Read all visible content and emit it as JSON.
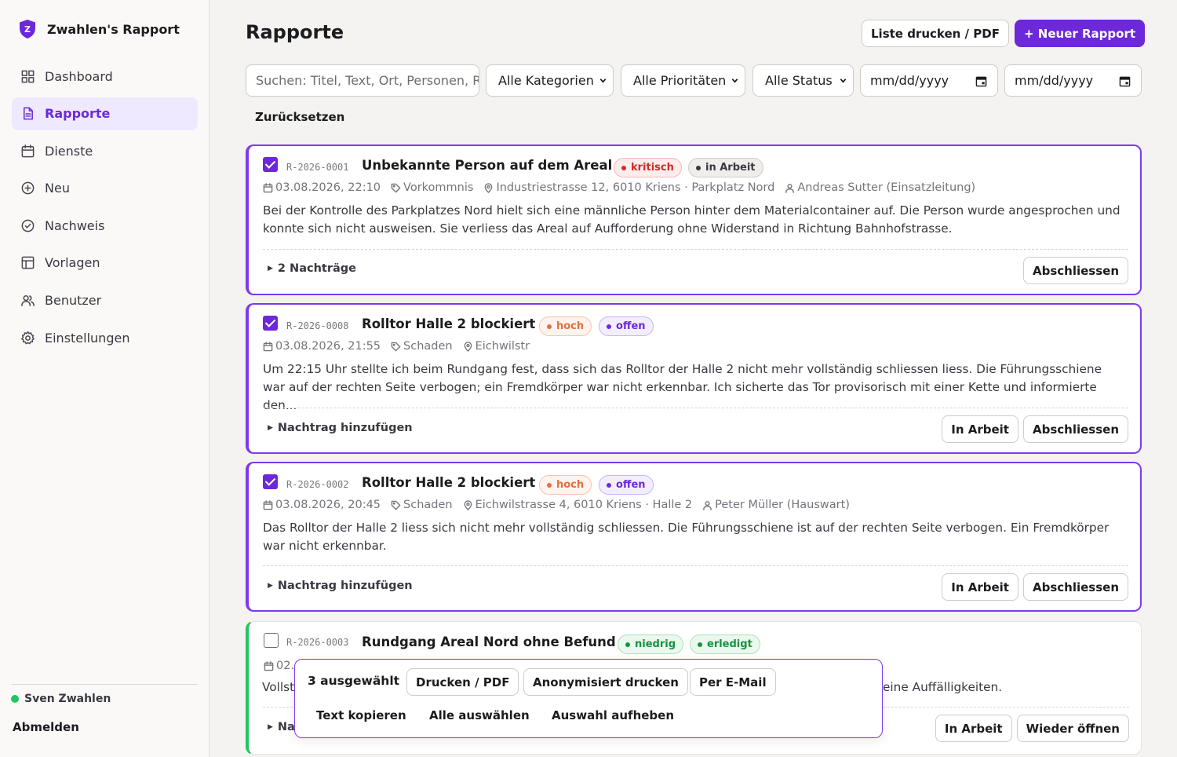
{
  "app": {
    "title": "Zwahlen's Rapport",
    "logo_letter": "Z"
  },
  "sidebar": {
    "items": [
      {
        "label": "Dashboard",
        "icon": "dashboard-icon"
      },
      {
        "label": "Rapporte",
        "icon": "document-icon",
        "active": true
      },
      {
        "label": "Dienste",
        "icon": "calendar-icon"
      },
      {
        "label": "Neu",
        "icon": "plus-circle-icon"
      },
      {
        "label": "Nachweis",
        "icon": "check-circle-icon"
      },
      {
        "label": "Vorlagen",
        "icon": "template-icon"
      },
      {
        "label": "Benutzer",
        "icon": "users-icon"
      },
      {
        "label": "Einstellungen",
        "icon": "gear-icon"
      }
    ],
    "user": {
      "name": "Sven Zwahlen",
      "status_color": "#22c55e"
    },
    "logout_label": "Abmelden"
  },
  "header": {
    "title": "Rapporte",
    "print_list_label": "Liste drucken / PDF",
    "new_report_label": "+ Neuer Rapport"
  },
  "filters": {
    "search_placeholder": "Suchen: Titel, Text, Ort, Personen, R",
    "category": "Alle Kategorien",
    "priority": "Alle Prioritäten",
    "status": "Alle Status",
    "date_from": "mm/dd/yyyy",
    "date_to": "mm/dd/yyyy",
    "reset_label": "Zurücksetzen"
  },
  "reports": [
    {
      "id": "R-2026-0001",
      "title": "Unbekannte Person auf dem Areal",
      "checked": true,
      "priority": "kritisch",
      "status": "in Arbeit",
      "date": "03.08.2026, 22:10",
      "category": "Vorkommnis",
      "location": "Industriestrasse 12, 6010 Kriens · Parkplatz Nord",
      "person": "Andreas Sutter (Einsatzleitung)",
      "text": "Bei der Kontrolle des Parkplatzes Nord hielt sich eine männliche Person hinter dem Materialcontainer auf. Die Person wurde angesprochen und konnte sich nicht ausweisen. Sie verliess das Areal auf Aufforderung ohne Widerstand in Richtung Bahnhofstrasse.",
      "addendum": "2 Nachträge",
      "actions": [
        "Abschliessen"
      ]
    },
    {
      "id": "R-2026-0008",
      "title": "Rolltor Halle 2 blockiert",
      "checked": true,
      "priority": "hoch",
      "status": "offen",
      "date": "03.08.2026, 21:55",
      "category": "Schaden",
      "location": "Eichwilstr",
      "text": "Um 22:15 Uhr stellte ich beim Rundgang fest, dass sich das Rolltor der Halle 2 nicht mehr vollständig schliessen liess. Die Führungsschiene war auf der rechten Seite verbogen; ein Fremdkörper war nicht erkennbar. Ich sicherte das Tor provisorisch mit einer Kette und informierte den...",
      "addendum": "Nachtrag hinzufügen",
      "actions": [
        "In Arbeit",
        "Abschliessen"
      ]
    },
    {
      "id": "R-2026-0002",
      "title": "Rolltor Halle 2 blockiert",
      "checked": true,
      "priority": "hoch",
      "status": "offen",
      "date": "03.08.2026, 20:45",
      "category": "Schaden",
      "location": "Eichwilstrasse 4, 6010 Kriens · Halle 2",
      "person": "Peter Müller (Hauswart)",
      "text": "Das Rolltor der Halle 2 liess sich nicht mehr vollständig schliessen. Die Führungsschiene ist auf der rechten Seite verbogen. Ein Fremdkörper war nicht erkennbar.",
      "addendum": "Nachtrag hinzufügen",
      "actions": [
        "In Arbeit",
        "Abschliessen"
      ]
    },
    {
      "id": "R-2026-0003",
      "title": "Rundgang Areal Nord ohne Befund",
      "checked": false,
      "priority": "niedrig",
      "status": "erledigt",
      "date_partial": "02.0",
      "text_start": "Vollst",
      "text_end": "eine Auffälligkeiten.",
      "addendum_partial": "Na",
      "actions": [
        "In Arbeit",
        "Wieder öffnen"
      ]
    }
  ],
  "bulk": {
    "count_label": "3 ausgewählt",
    "print_label": "Drucken / PDF",
    "anon_print_label": "Anonymisiert drucken",
    "email_label": "Per E-Mail",
    "copy_label": "Text kopieren",
    "select_all_label": "Alle auswählen",
    "clear_label": "Auswahl aufheben"
  },
  "colors": {
    "accent": "#6d28d9",
    "done": "#22c55e",
    "critical": "#d12b2b",
    "high": "#e2703d"
  }
}
